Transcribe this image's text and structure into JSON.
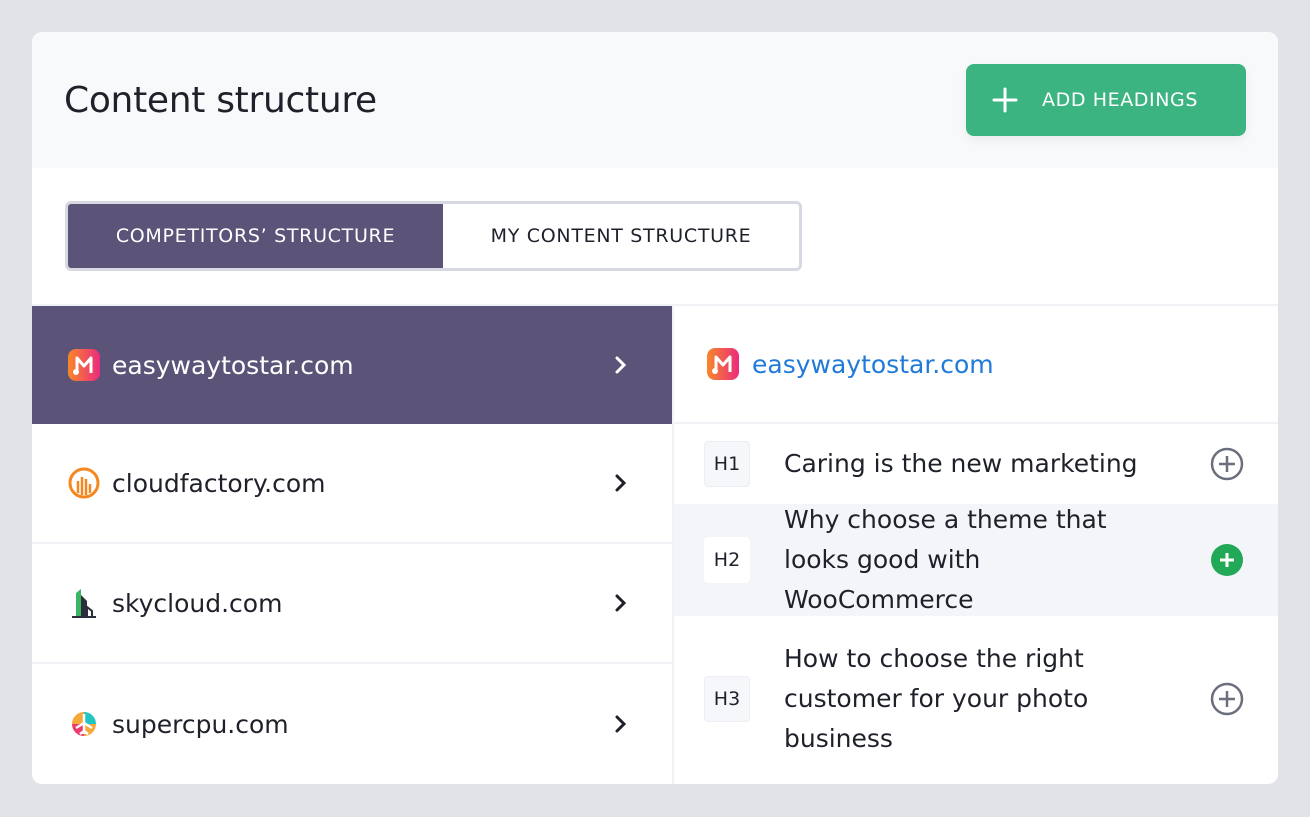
{
  "header": {
    "title": "Content structure",
    "add_button_label": "ADD HEADINGS",
    "add_button_icon": "plus-icon"
  },
  "colors": {
    "accent_green": "#3bb482",
    "active_purple": "#5b5478",
    "link_blue": "#1f7ad9",
    "add_active_green": "#21a957"
  },
  "tabs": [
    {
      "label": "COMPETITORS’ STRUCTURE",
      "active": true
    },
    {
      "label": "MY CONTENT STRUCTURE",
      "active": false
    }
  ],
  "competitors": [
    {
      "domain": "easywaytostar.com",
      "icon": "music-m-logo-icon",
      "active": true
    },
    {
      "domain": "cloudfactory.com",
      "icon": "bar-chart-circle-logo-icon",
      "active": false
    },
    {
      "domain": "skycloud.com",
      "icon": "buildings-logo-icon",
      "active": false
    },
    {
      "domain": "supercpu.com",
      "icon": "airplane-logo-icon",
      "active": false
    }
  ],
  "selected": {
    "domain": "easywaytostar.com",
    "headings": [
      {
        "level": "H1",
        "text": "Caring is the new marketing",
        "highlighted": false,
        "added": false
      },
      {
        "level": "H2",
        "text": "Why choose a theme that looks good with WooCommerce",
        "highlighted": true,
        "added": true
      },
      {
        "level": "H3",
        "text": "How to choose the right customer for your photo business",
        "highlighted": false,
        "added": false
      }
    ]
  }
}
